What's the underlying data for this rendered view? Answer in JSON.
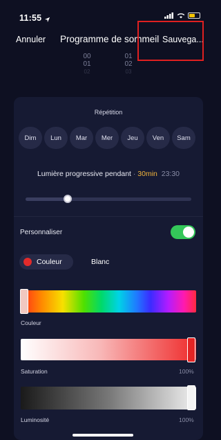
{
  "status_bar": {
    "time": "11:55"
  },
  "header": {
    "cancel_label": "Annuler",
    "title": "Programme de sommeil",
    "save_label": "Sauvega..."
  },
  "time_picker": {
    "hours": [
      "00",
      "01",
      "02"
    ],
    "minutes": [
      "01",
      "02",
      "03"
    ]
  },
  "repetition": {
    "label": "Répétition",
    "days": [
      "Dim",
      "Lun",
      "Mar",
      "Mer",
      "Jeu",
      "Ven",
      "Sam"
    ]
  },
  "progressive_light": {
    "label": "Lumière progressive pendant",
    "separator": "·",
    "duration": "30min",
    "end_time": "23:30",
    "slider_level_fraction": 0.27
  },
  "customize": {
    "label": "Personnaliser",
    "toggle_on": true
  },
  "color_mode": {
    "options": [
      "Couleur",
      "Blanc"
    ],
    "selected": "Couleur"
  },
  "controls": {
    "color": {
      "label": "Couleur",
      "value_text": ""
    },
    "saturation": {
      "label": "Saturation",
      "value_text": "100%"
    },
    "luminosity": {
      "label": "Luminosité",
      "value_text": "100%"
    }
  },
  "colors": {
    "background": "#0e1022",
    "card": "#161a33",
    "accent_time": "#f2b53c",
    "toggle_on": "#34c759",
    "selected_color": "#e22b2b",
    "highlight_box": "#e02020"
  },
  "icons": [
    "location-arrow-icon",
    "signal-icon",
    "wifi-icon",
    "battery-icon",
    "color-dot-icon"
  ]
}
